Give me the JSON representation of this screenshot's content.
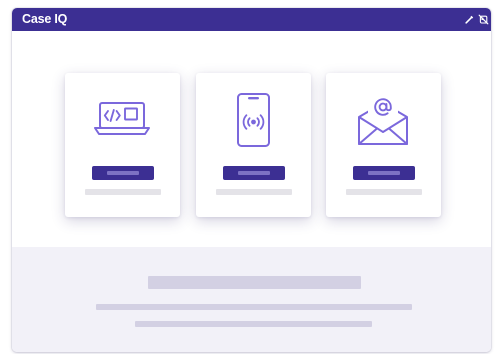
{
  "app": {
    "brand": "Case IQ"
  },
  "titlebar": {
    "actions": [
      {
        "icon": "edit-pencil-icon"
      },
      {
        "icon": "hide-icon"
      }
    ]
  },
  "cards": [
    {
      "icon": "laptop-code-icon",
      "button_label": "",
      "caption": ""
    },
    {
      "icon": "smartphone-wireless-icon",
      "button_label": "",
      "caption": ""
    },
    {
      "icon": "email-at-icon",
      "button_label": "",
      "caption": ""
    }
  ],
  "footer": {
    "heading": "",
    "lines": [
      "",
      ""
    ]
  },
  "colors": {
    "accent": "#3c2f93",
    "icon_stroke": "#7b68dc",
    "placeholder_bar": "#d3d0e3",
    "caption_bar": "#e4e3e8",
    "footer_bg": "#f2f1f8"
  }
}
